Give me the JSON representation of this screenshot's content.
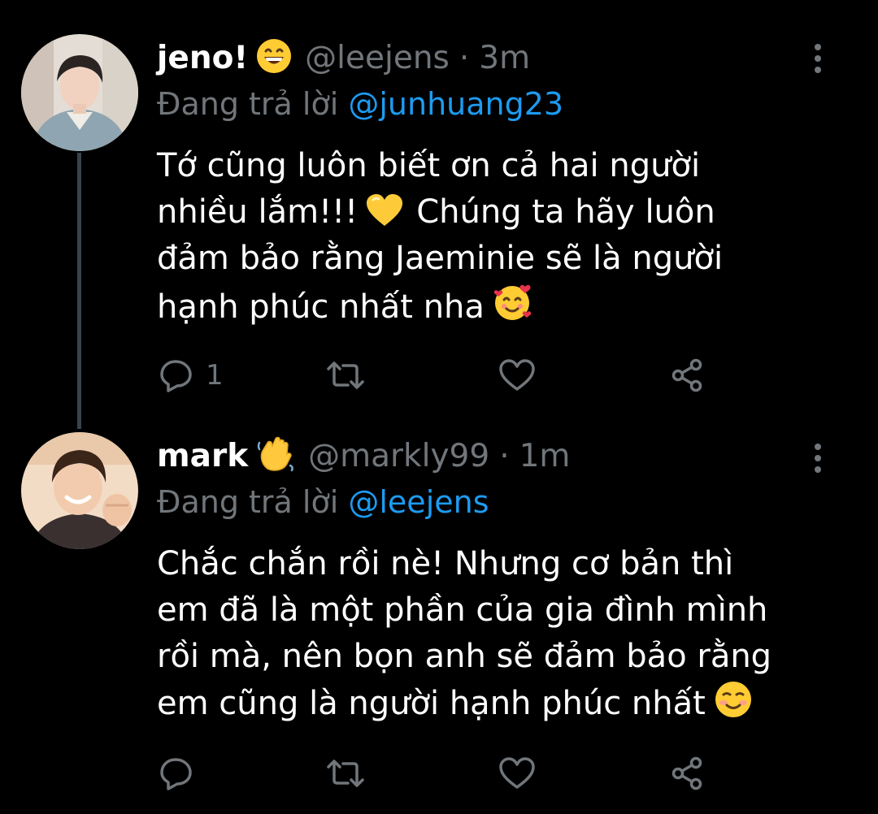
{
  "tweets": [
    {
      "display_name": "jeno!",
      "name_emoji": "grinning-face-emoji",
      "handle": "@leejens",
      "separator": "·",
      "time": "3m",
      "replying_prefix": "Đang trả lời",
      "replying_to": "@junhuang23",
      "body_lines": [
        "Tớ cũng luôn biết ơn cả hai người",
        "nhiều lắm!!!",
        "Chúng ta hãy luôn",
        "đảm bảo rằng Jaeminie sẽ là người",
        "hạnh phúc nhất nha"
      ],
      "reply_count": "1"
    },
    {
      "display_name": "mark",
      "name_emoji": "waving-hand-emoji",
      "handle": "@markly99",
      "separator": "·",
      "time": "1m",
      "replying_prefix": "Đang trả lời",
      "replying_to": "@leejens",
      "body_lines": [
        "Chắc chắn rồi nè! Nhưng cơ bản thì",
        "em đã là một phần của gia đình mình",
        "rồi mà, nên bọn anh sẽ đảm bảo rằng",
        "em cũng là người hạnh phúc nhất"
      ],
      "reply_count": ""
    }
  ],
  "colors": {
    "background": "#000000",
    "text": "#ffffff",
    "secondary": "#71767b",
    "link": "#1d9bf0",
    "thread_line": "#38444d"
  }
}
